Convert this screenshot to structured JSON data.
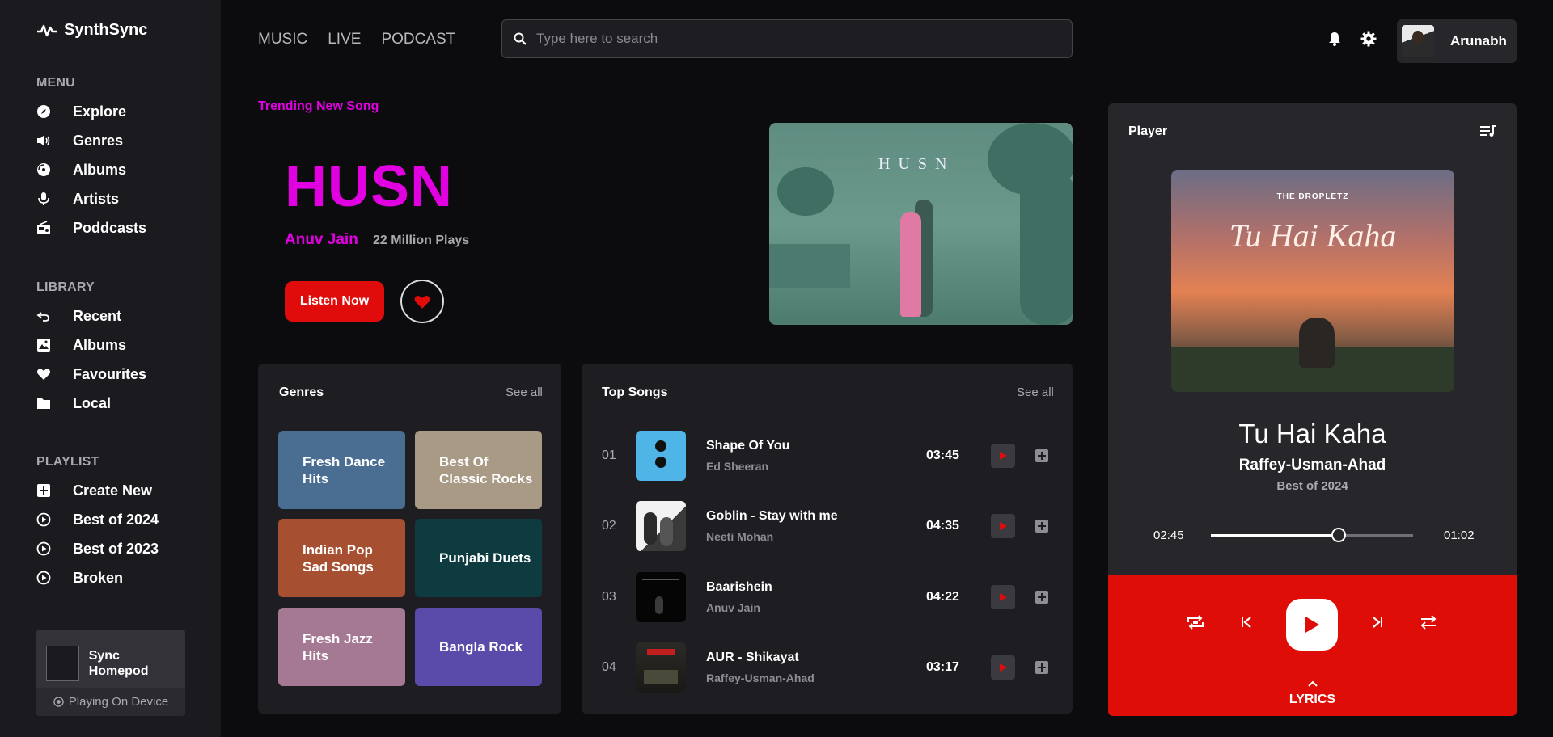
{
  "app": {
    "name": "SynthSync"
  },
  "sidebar": {
    "menu_title": "MENU",
    "menu": [
      {
        "label": "Explore",
        "icon": "compass-icon"
      },
      {
        "label": "Genres",
        "icon": "speaker-icon"
      },
      {
        "label": "Albums",
        "icon": "disc-icon"
      },
      {
        "label": "Artists",
        "icon": "microphone-icon"
      },
      {
        "label": "Poddcasts",
        "icon": "radio-icon"
      }
    ],
    "library_title": "LIBRARY",
    "library": [
      {
        "label": "Recent",
        "icon": "undo-icon"
      },
      {
        "label": "Albums",
        "icon": "image-icon"
      },
      {
        "label": "Favourites",
        "icon": "heart-icon"
      },
      {
        "label": "Local",
        "icon": "folder-icon"
      }
    ],
    "playlist_title": "PLAYLIST",
    "playlist": [
      {
        "label": "Create New",
        "icon": "plus-square-icon"
      },
      {
        "label": "Best of 2024",
        "icon": "play-circle-icon"
      },
      {
        "label": "Best of 2023",
        "icon": "play-circle-icon"
      },
      {
        "label": "Broken",
        "icon": "play-circle-icon"
      }
    ],
    "device": {
      "name": "Sync Homepod",
      "status": "Playing On Device"
    }
  },
  "topnav": [
    "MUSIC",
    "LIVE",
    "PODCAST"
  ],
  "search": {
    "placeholder": "Type here to search",
    "value": ""
  },
  "user": {
    "name": "Arunabh"
  },
  "hero": {
    "label": "Trending New Song",
    "title": "HUSN",
    "artist": "Anuv Jain",
    "plays": "22 Million Plays",
    "listen_label": "Listen Now",
    "image_text": "HUSN"
  },
  "genres": {
    "title": "Genres",
    "see_all": "See all",
    "items": [
      {
        "label": "Fresh Dance Hits",
        "color": "#4a6e92"
      },
      {
        "label": "Best Of Classic Rocks",
        "color": "#a89a84"
      },
      {
        "label": "Indian Pop Sad Songs",
        "color": "#a64f31"
      },
      {
        "label": "Punjabi Duets",
        "color": "#0d3b40"
      },
      {
        "label": "Fresh Jazz Hits",
        "color": "#a57894"
      },
      {
        "label": "Bangla Rock",
        "color": "#5a4aa9"
      }
    ]
  },
  "top_songs": {
    "title": "Top Songs",
    "see_all": "See all",
    "items": [
      {
        "num": "01",
        "title": "Shape Of You",
        "artist": "Ed Sheeran",
        "duration": "03:45"
      },
      {
        "num": "02",
        "title": "Goblin - Stay with me",
        "artist": "Neeti Mohan",
        "duration": "04:35"
      },
      {
        "num": "03",
        "title": "Baarishein",
        "artist": "Anuv Jain",
        "duration": "04:22"
      },
      {
        "num": "04",
        "title": "AUR - Shikayat",
        "artist": "Raffey-Usman-Ahad",
        "duration": "03:17"
      }
    ]
  },
  "player": {
    "title": "Player",
    "cover_brand": "THE DROPLETZ",
    "cover_script": "Tu Hai Kaha",
    "track": "Tu Hai Kaha",
    "artist": "Raffey-Usman-Ahad",
    "album": "Best of 2024",
    "elapsed": "02:45",
    "remaining": "01:02",
    "progress": 0.63,
    "lyrics_label": "LYRICS"
  },
  "colors": {
    "accent": "#e000e0",
    "brand_red": "#df0d08",
    "bg": "#0c0c0e",
    "panel": "#1e1e22"
  }
}
